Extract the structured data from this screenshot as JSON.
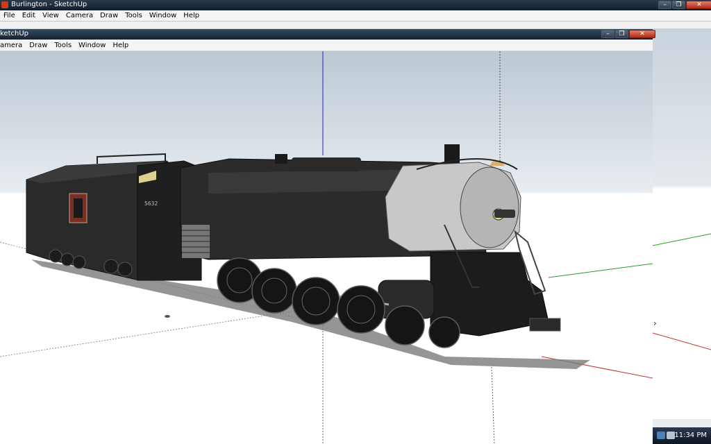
{
  "back_window": {
    "title": "Burlington - SketchUp",
    "menu": [
      "File",
      "Edit",
      "View",
      "Camera",
      "Draw",
      "Tools",
      "Window",
      "Help"
    ],
    "buttons": {
      "minimize": "–",
      "maximize": "❐",
      "close": "✕"
    }
  },
  "front_window": {
    "title": "ketchUp",
    "menu": [
      "amera",
      "Draw",
      "Tools",
      "Window",
      "Help"
    ],
    "buttons": {
      "minimize": "–",
      "maximize": "❐",
      "close": "✕"
    }
  },
  "model": {
    "locomotive_number": "5632"
  },
  "taskbar": {
    "clock": "11:34 PM"
  },
  "colors": {
    "titlebar": "#1b2836",
    "close_button": "#c0391b",
    "sky_top": "#bcc8d2",
    "ground": "#ffffff",
    "axis_red": "#c03030",
    "axis_green": "#2a9a2a",
    "axis_blue": "#2020c0",
    "boiler_front": "#c9c9c9"
  }
}
